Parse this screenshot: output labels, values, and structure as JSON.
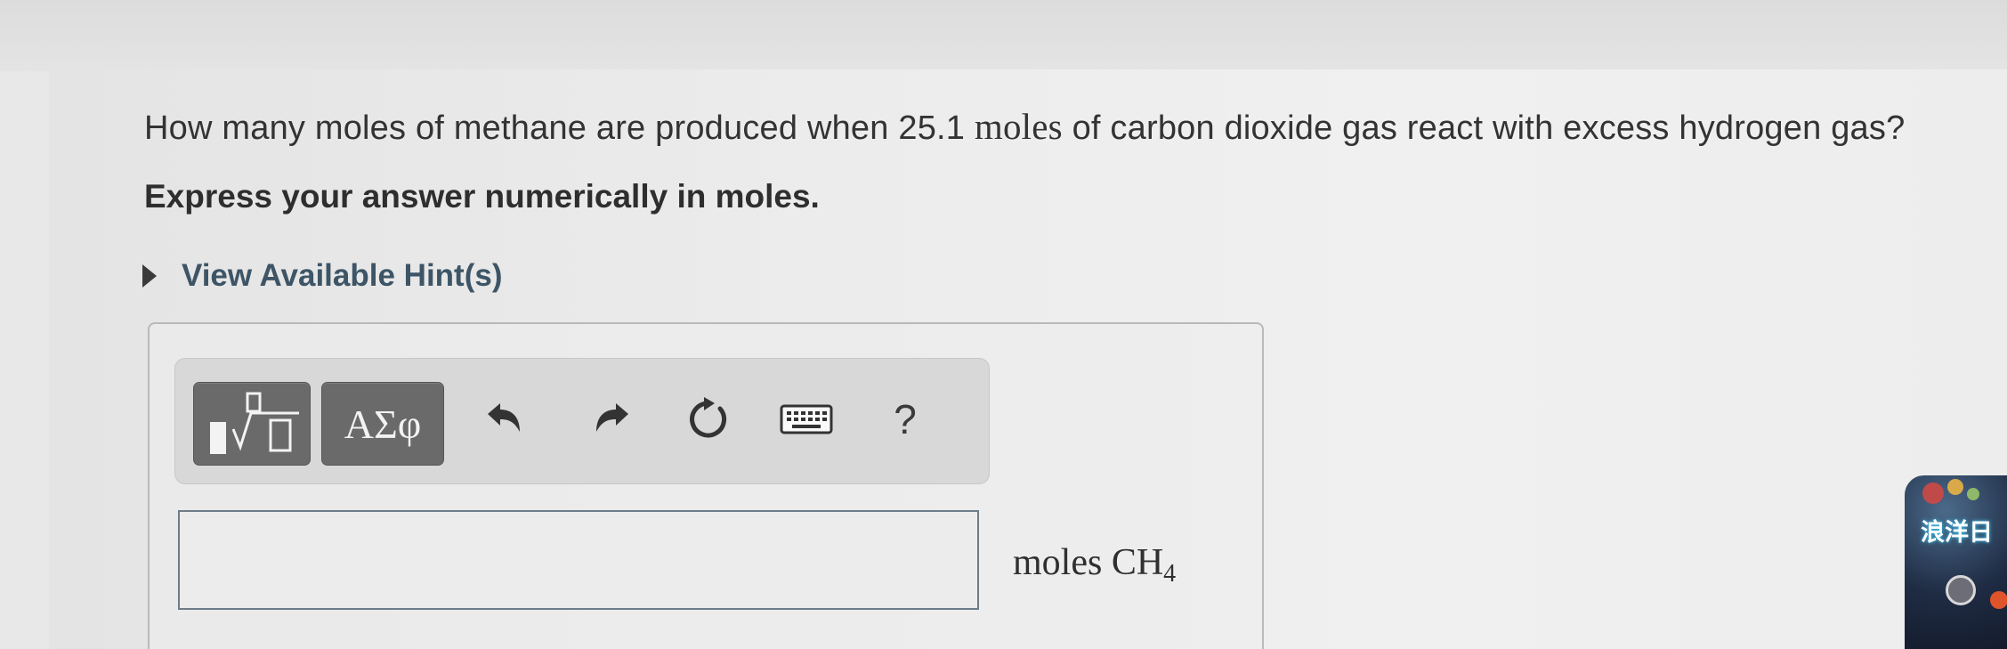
{
  "question": {
    "text_before": "How many moles of methane are produced when 25.1 ",
    "text_moles": "moles",
    "text_after": " of carbon dioxide gas react with excess hydrogen gas?"
  },
  "instruction": "Express your answer numerically in moles.",
  "hint": {
    "label": "View Available Hint(s)",
    "icon": "triangle-right-icon"
  },
  "toolbar": {
    "templates_icon": "math-templates-icon",
    "greek_label": "ΑΣφ",
    "undo_icon": "undo-icon",
    "redo_icon": "redo-icon",
    "reset_icon": "reset-icon",
    "keyboard_icon": "keyboard-icon",
    "help_label": "?"
  },
  "answer": {
    "value": "",
    "unit_text": "moles CH",
    "unit_subscript": "4"
  },
  "overlay_widget": {
    "label": "浪洋日"
  },
  "colors": {
    "hint_link": "#3d5566",
    "toolbar_button": "#6a6a6a",
    "input_border": "#6c7d89",
    "page_bg": "#ececec"
  }
}
